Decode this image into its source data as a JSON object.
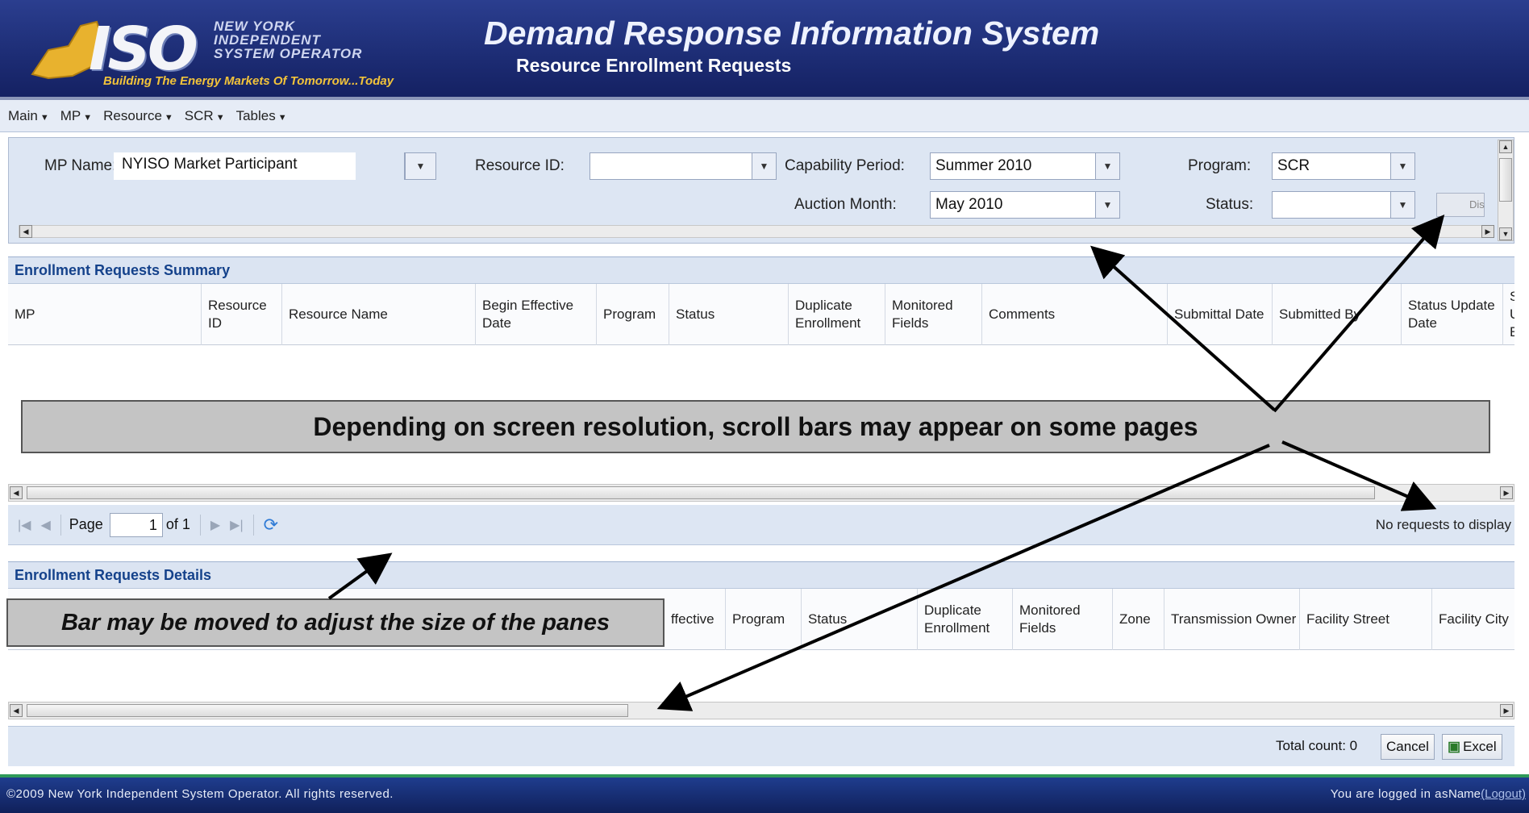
{
  "header": {
    "logo_iso": "ISO",
    "logo_ny": [
      "NEW YORK",
      "INDEPENDENT",
      "SYSTEM OPERATOR"
    ],
    "logo_tagline": "Building The Energy Markets Of Tomorrow...Today",
    "title": "Demand Response Information System",
    "subtitle": "Resource Enrollment Requests"
  },
  "menu": [
    {
      "label": "Main"
    },
    {
      "label": "MP"
    },
    {
      "label": "Resource"
    },
    {
      "label": "SCR"
    },
    {
      "label": "Tables"
    }
  ],
  "filters": {
    "mp_name_label": "MP Name:",
    "mp_name_value": "NYISO Market Participant",
    "resource_id_label": "Resource ID:",
    "resource_id_value": "",
    "capability_period_label": "Capability Period:",
    "capability_period_value": "Summer 2010",
    "auction_month_label": "Auction Month:",
    "auction_month_value": "May 2010",
    "program_label": "Program:",
    "program_value": "SCR",
    "status_label": "Status:",
    "status_value": "",
    "display_button_label": "Dis"
  },
  "summary": {
    "title": "Enrollment Requests Summary",
    "columns": [
      "MP",
      "Resource ID",
      "Resource Name",
      "Begin Effective Date",
      "Program",
      "Status",
      "Duplicate Enrollment",
      "Monitored Fields",
      "Comments",
      "Submittal Date",
      "Submitted By",
      "Status Update Date",
      "S U E"
    ]
  },
  "pager": {
    "page_label": "Page",
    "page_value": "1",
    "of_label": "of 1",
    "empty_message": "No requests to display"
  },
  "details": {
    "title": "Enrollment Requests Details",
    "columns": [
      "ffective",
      "Program",
      "Status",
      "Duplicate Enrollment",
      "Monitored Fields",
      "Zone",
      "Transmission Owner",
      "Facility Street",
      "Facility City"
    ]
  },
  "bottom": {
    "total_count": "Total count: 0",
    "cancel_label": "Cancel",
    "excel_label": "Excel"
  },
  "footer": {
    "copyright": "©2009   New York Independent System Operator. All rights reserved.",
    "logged_in": "You are logged in as",
    "user": "Name",
    "logout": "(Logout)"
  },
  "callouts": {
    "scrollbars": "Depending on screen resolution, scroll bars may appear on some pages",
    "bar": "Bar may be moved to adjust the size of the panes"
  },
  "colors": {
    "header_bg": "#1d2d75",
    "panel_bg": "#dde6f3",
    "panel_title": "#15428b",
    "logo_accent": "#f2c33a"
  }
}
